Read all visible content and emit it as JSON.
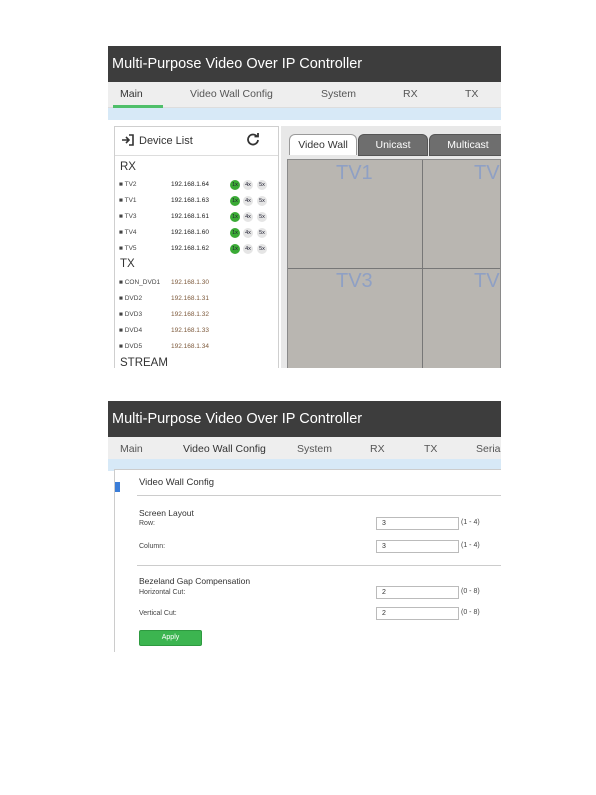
{
  "app": {
    "title": "Multi-Purpose Video Over IP Controller"
  },
  "colors": {
    "header_bg": "#3d3d3d",
    "accent_green": "#4fbf6a",
    "tx_badge_green": "#3aaa35",
    "apply_button": "#3cb550",
    "tv_label": "#8fa0c4"
  },
  "screen1": {
    "nav": [
      {
        "label": "Main",
        "active": true
      },
      {
        "label": "Video Wall Config"
      },
      {
        "label": "System"
      },
      {
        "label": "RX"
      },
      {
        "label": "TX"
      }
    ],
    "device_list": {
      "title": "Device List",
      "icons": [
        "login-arrow-icon",
        "refresh-icon"
      ],
      "rx_title": "RX",
      "rx": [
        {
          "name": "TV2",
          "ip": "192.168.1.64",
          "b1": "1x",
          "b4": "4x",
          "b5": "5x"
        },
        {
          "name": "TV1",
          "ip": "192.168.1.63",
          "b1": "1x",
          "b4": "4x",
          "b5": "5x"
        },
        {
          "name": "TV3",
          "ip": "192.168.1.61",
          "b1": "1x",
          "b4": "4x",
          "b5": "5x"
        },
        {
          "name": "TV4",
          "ip": "192.168.1.60",
          "b1": "1x",
          "b4": "4x",
          "b5": "5x"
        },
        {
          "name": "TV5",
          "ip": "192.168.1.62",
          "b1": "1x",
          "b4": "4x",
          "b5": "5x"
        }
      ],
      "tx_title": "TX",
      "tx": [
        {
          "name": "CON_DVD1",
          "ip": "192.168.1.30"
        },
        {
          "name": "DVD2",
          "ip": "192.168.1.31"
        },
        {
          "name": "DVD3",
          "ip": "192.168.1.32"
        },
        {
          "name": "DVD4",
          "ip": "192.168.1.33"
        },
        {
          "name": "DVD5",
          "ip": "192.168.1.34"
        }
      ],
      "stream_title": "STREAM"
    },
    "tabs": [
      "Video Wall",
      "Unicast",
      "Multicast"
    ],
    "wall": {
      "tv1": "TV1",
      "tv2": "TV",
      "tv3": "TV3",
      "tv4": "TV"
    }
  },
  "screen2": {
    "nav": [
      {
        "label": "Main"
      },
      {
        "label": "Video Wall Config",
        "active": true
      },
      {
        "label": "System"
      },
      {
        "label": "RX"
      },
      {
        "label": "TX"
      },
      {
        "label": "Serial"
      }
    ],
    "card_title": "Video Wall Config",
    "screen_layout": {
      "title": "Screen Layout",
      "row_label": "Row:",
      "row_value": "3",
      "row_range": "(1 - 4)",
      "col_label": "Column:",
      "col_value": "3",
      "col_range": "(1 - 4)"
    },
    "bezel": {
      "title": "Bezeland Gap Compensation",
      "h_label": "Horizontal Cut:",
      "h_value": "2",
      "h_range": "(0 - 8)",
      "v_label": "Vertical Cut:",
      "v_value": "2",
      "v_range": "(0 - 8)"
    },
    "apply_label": "Apply"
  }
}
